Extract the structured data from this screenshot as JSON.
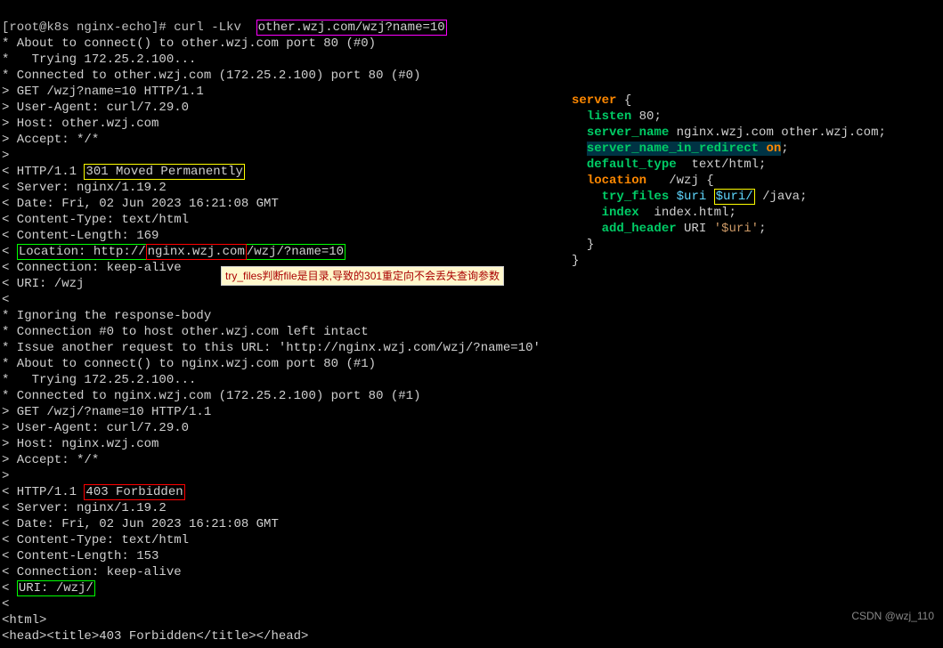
{
  "prompt": "[root@k8s nginx-echo]# curl -Lkv  ",
  "url": "other.wzj.com/wzj?name=10",
  "lines": {
    "l1": "* About to connect() to other.wzj.com port 80 (#0)",
    "l2": "*   Trying 172.25.2.100...",
    "l3": "* Connected to other.wzj.com (172.25.2.100) port 80 (#0)",
    "l4": "> GET /wzj?name=10 HTTP/1.1",
    "l5": "> User-Agent: curl/7.29.0",
    "l6": "> Host: other.wzj.com",
    "l7": "> Accept: */*",
    "l8": "> ",
    "l9a": "< HTTP/1.1 ",
    "l9b": "301 Moved Permanently",
    "l10": "< Server: nginx/1.19.2",
    "l11": "< Date: Fri, 02 Jun 2023 16:21:08 GMT",
    "l12": "< Content-Type: text/html",
    "l13": "< Content-Length: 169",
    "l14a": "< ",
    "l14b": "Location: http://",
    "l14c": "nginx.wzj.com",
    "l14d": "/wzj/?name=10",
    "l15": "< Connection: keep-alive",
    "l16": "< URI: /wzj",
    "l17": "< ",
    "l18": "* Ignoring the response-body",
    "l19": "* Connection #0 to host other.wzj.com left intact",
    "l20": "* Issue another request to this URL: 'http://nginx.wzj.com/wzj/?name=10'",
    "l21": "* About to connect() to nginx.wzj.com port 80 (#1)",
    "l22": "*   Trying 172.25.2.100...",
    "l23": "* Connected to nginx.wzj.com (172.25.2.100) port 80 (#1)",
    "l24": "> GET /wzj/?name=10 HTTP/1.1",
    "l25": "> User-Agent: curl/7.29.0",
    "l26": "> Host: nginx.wzj.com",
    "l27": "> Accept: */*",
    "l28": "> ",
    "l29a": "< HTTP/1.1 ",
    "l29b": "403 Forbidden",
    "l30": "< Server: nginx/1.19.2",
    "l31": "< Date: Fri, 02 Jun 2023 16:21:08 GMT",
    "l32": "< Content-Type: text/html",
    "l33": "< Content-Length: 153",
    "l34": "< Connection: keep-alive",
    "l35a": "< ",
    "l35b": "URI: /wzj/",
    "l36": "< ",
    "l37": "<html>",
    "l38": "<head><title>403 Forbidden</title></head>"
  },
  "nginx": {
    "server": "server",
    "listen": "listen",
    "port": " 80;",
    "server_name": "server_name",
    "server_names": " nginx.wzj.com other.wzj.com;",
    "snir": "server_name_in_redirect",
    "on": "on",
    "semi": ";",
    "default_type": "default_type",
    "texthtml": "  text/html;",
    "location": "location",
    "locpath": "   /wzj {",
    "try_files": "try_files",
    "uri1": "$uri",
    "uri2": "$uri/",
    "java": " /java;",
    "index": "index",
    "indexhtml": "  index.html;",
    "add_header": "add_header",
    "hdrname": " URI ",
    "hdrval": "'$uri'",
    "close1": "}",
    "close2": "}"
  },
  "annotation": "try_files判断file是目录,导致的301重定向不会丢失查询参数",
  "watermark": "CSDN @wzj_110"
}
